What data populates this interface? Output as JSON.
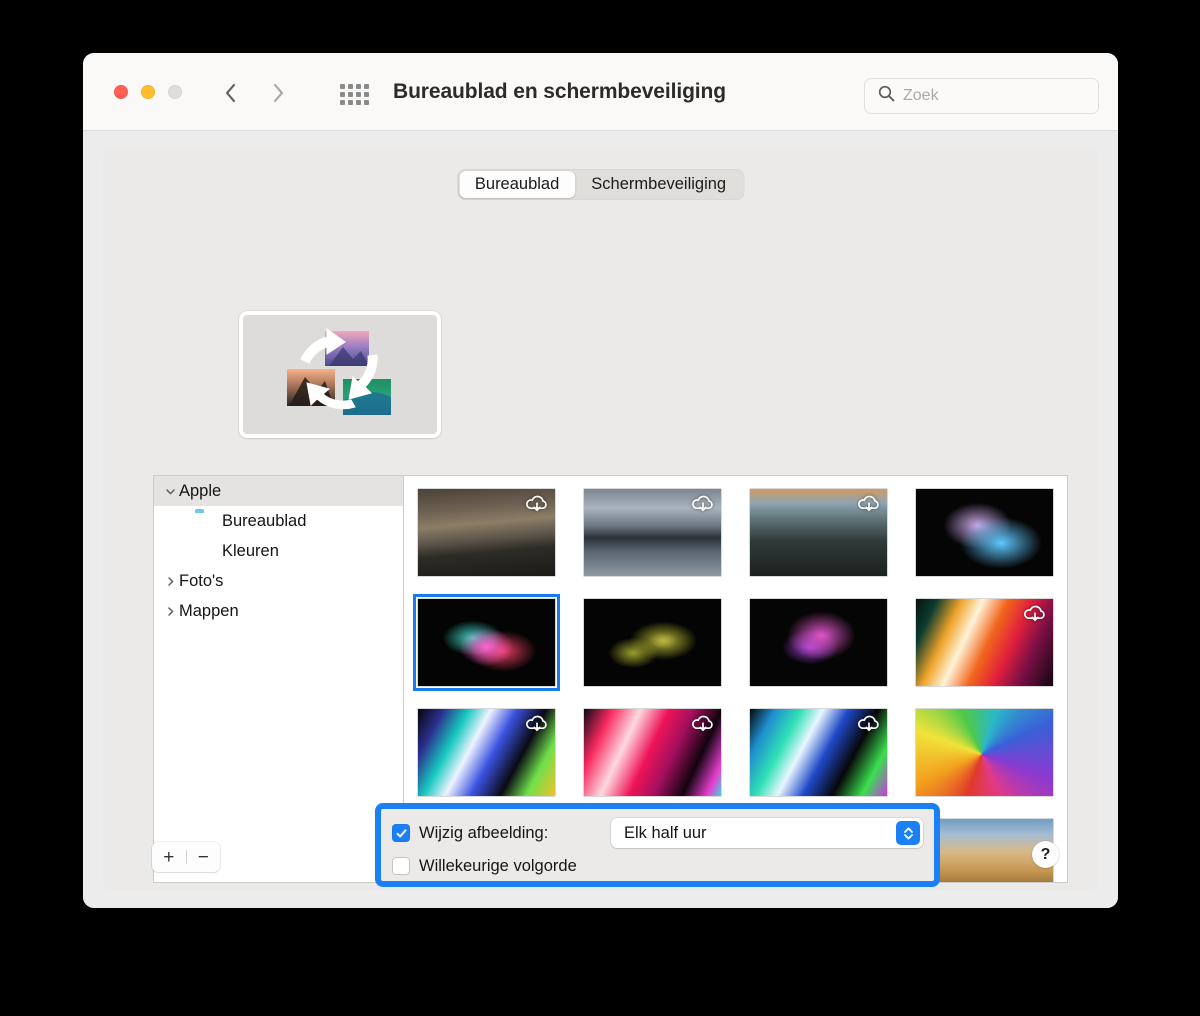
{
  "window": {
    "title": "Bureaublad en schermbeveiliging",
    "traffic_lights": [
      {
        "name": "close",
        "color": "#ff5f57"
      },
      {
        "name": "minimize",
        "color": "#febc2e"
      },
      {
        "name": "zoom",
        "color": "#dddddd"
      }
    ]
  },
  "toolbar": {
    "back_icon": "chevron-left-icon",
    "forward_icon": "chevron-right-icon",
    "grid_icon": "show-all-grid-icon",
    "search": {
      "icon": "search-icon",
      "placeholder": "Zoek",
      "value": ""
    }
  },
  "tabs": [
    {
      "label": "Bureaublad",
      "active": true
    },
    {
      "label": "Schermbeveiliging",
      "active": false
    }
  ],
  "preview": {
    "name": "desktop-rotation-preview",
    "description": "Roterende bureaubladafbeeldingen"
  },
  "sidebar": {
    "items": [
      {
        "label": "Apple",
        "level": 0,
        "twisty": "chevron-down-icon",
        "selected": true,
        "icon": null
      },
      {
        "label": "Bureaublad",
        "level": 1,
        "twisty": null,
        "selected": false,
        "icon": "folder-icon"
      },
      {
        "label": "Kleuren",
        "level": 1,
        "twisty": null,
        "selected": false,
        "icon": "color-wheel-icon"
      },
      {
        "label": "Foto's",
        "level": 0,
        "twisty": "chevron-right-icon",
        "selected": false,
        "icon": null
      },
      {
        "label": "Mappen",
        "level": 0,
        "twisty": "chevron-right-icon",
        "selected": false,
        "icon": null
      }
    ],
    "add_button": "+",
    "remove_button": "−"
  },
  "wallpaper_grid": {
    "selected_index": 4,
    "items": [
      {
        "name": "ocean-sunset-dark",
        "cloud": true,
        "style": "linear-gradient(175deg,#4a4237 0%,#6d6152 24%,#8c7d66 40%,#5d564a 56%,#2e2c27 70%,#1b1a18 100%)"
      },
      {
        "name": "island-seascape",
        "cloud": true,
        "style": "linear-gradient(180deg,#7b8693 0%,#aab3bd 22%,#6d7884 42%,#2b3138 56%,#5b6670 72%,#8e99a3 100%)"
      },
      {
        "name": "coastal-fog-cliffs",
        "cloud": true,
        "style": "linear-gradient(180deg,#cf9a63 0%,#8ea6b2 16%,#5c6f73 36%,#2f3a38 60%,#1b2220 100%)"
      },
      {
        "name": "flowers-blue-blossoms",
        "cloud": false,
        "style": "radial-gradient(ellipse at 62% 62%, #5fc8ff 0%, rgba(95,200,255,0) 34%), radial-gradient(ellipse at 45% 42%, #c9a7e8 0%, rgba(201,167,232,0) 32%), #050505"
      },
      {
        "name": "flower-magenta-spiky",
        "cloud": false,
        "style": "radial-gradient(ellipse at 50% 55%, #ff63d0 0%, rgba(255,99,208,0) 28%), radial-gradient(ellipse at 40% 45%, #3fd0c0 0%, rgba(63,208,192,0) 26%), radial-gradient(ellipse at 62% 60%, #e03a5a 0%, rgba(224,58,90,0) 28%), #040404"
      },
      {
        "name": "flower-yellow-daisies",
        "cloud": false,
        "style": "radial-gradient(ellipse at 58% 48%, #b8b832 0%, rgba(184,184,50,0) 30%), radial-gradient(ellipse at 58% 48%, #6d3f8c 0%, rgba(109,63,140,0) 12%), radial-gradient(ellipse at 36% 62%, #9aa02c 0%, rgba(154,160,44,0) 20%), #040404"
      },
      {
        "name": "tree-pink-blossom",
        "cloud": false,
        "style": "radial-gradient(ellipse at 52% 42%, #e055c8 0%, rgba(224,85,200,0) 34%), radial-gradient(ellipse at 44% 55%, #a043d8 0%, rgba(160,67,216,0) 26%), #050505"
      },
      {
        "name": "abstract-warm-flow",
        "cloud": true,
        "style": "linear-gradient(115deg,#07130f 0%,#0c3c2e 12%,#f0a32a 26%,#fff3d8 38%,#f2661c 52%,#e01f3d 66%,#7a0f46 80%,#120611 100%)"
      },
      {
        "name": "abstract-cyan-flow",
        "cloud": true,
        "style": "linear-gradient(118deg,#060608 0%,#2b2f8d 14%,#19c9c0 28%,#eef3ff 40%,#3a52e0 54%,#0a0a14 70%,#6fe04a 84%,#f2c02a 100%)"
      },
      {
        "name": "abstract-pink-flow",
        "cloud": true,
        "style": "linear-gradient(115deg,#0a0a16 0%,#f7285f 16%,#ffd9e0 32%,#ef1358 48%,#a40f5e 62%,#12040f 78%,#e83fd0 92%,#3ad9e0 100%)"
      },
      {
        "name": "abstract-green-flow",
        "cloud": true,
        "style": "linear-gradient(118deg,#06070a 0%,#1f8fd0 14%,#2fe0b4 28%,#e8f6ff 40%,#1f49c8 54%,#070709 70%,#3ae04f 86%,#c838e0 100%)"
      },
      {
        "name": "color-burst-swirl",
        "cloud": false,
        "style": "conic-gradient(from 200deg at 48% 52%, #e03a2a, #f2a01e, #f0e33a, #4ec94a, #2ab8c8, #3a60d8, #8b3ad0, #e03a8a, #e03a2a)"
      },
      {
        "name": "color-burst-radial",
        "cloud": false,
        "style": "conic-gradient(from 20deg at 45% 50%, #f0e33a, #62d04a, #2ab8c8, #3a78e0, #a03ad0, #e03a7a, #f2541e, #f0e33a)"
      },
      {
        "name": "stripes-orange-blue",
        "cloud": false,
        "style": "linear-gradient(100deg,#7a1f8c 0%,#2a2f8c 14%,#1a8fb8 26%,#f2a01e 40%,#f2481e 55%,#e01f2a 70%,#9fe0f0 86%,#3a5ac8 100%)"
      },
      {
        "name": "moire-orange-purple",
        "cloud": false,
        "style": "linear-gradient(120deg,#f0821e 0%,#2a2040 22%,#6a4a6a 38%,#2fb8c8 50%,#1a2060 66%,#e0621e 84%,#2a1a3a 100%)"
      },
      {
        "name": "mojave-desert-dunes",
        "cloud": false,
        "style": "linear-gradient(180deg,#6f9ec4 0%,#a7bcd0 18%,#d8b886 38%,#c79a53 58%,#9a6f38 78%,#5f4424 100%)"
      }
    ]
  },
  "options": {
    "change_picture": {
      "label": "Wijzig afbeelding:",
      "checked": true,
      "interval_value": "Elk half uur",
      "stepper_icon": "chevron-up-down-icon"
    },
    "random_order": {
      "label": "Willekeurige volgorde",
      "checked": false
    },
    "highlight_color": "#1b80f5"
  },
  "help_button": {
    "label": "?",
    "name": "help-button"
  }
}
